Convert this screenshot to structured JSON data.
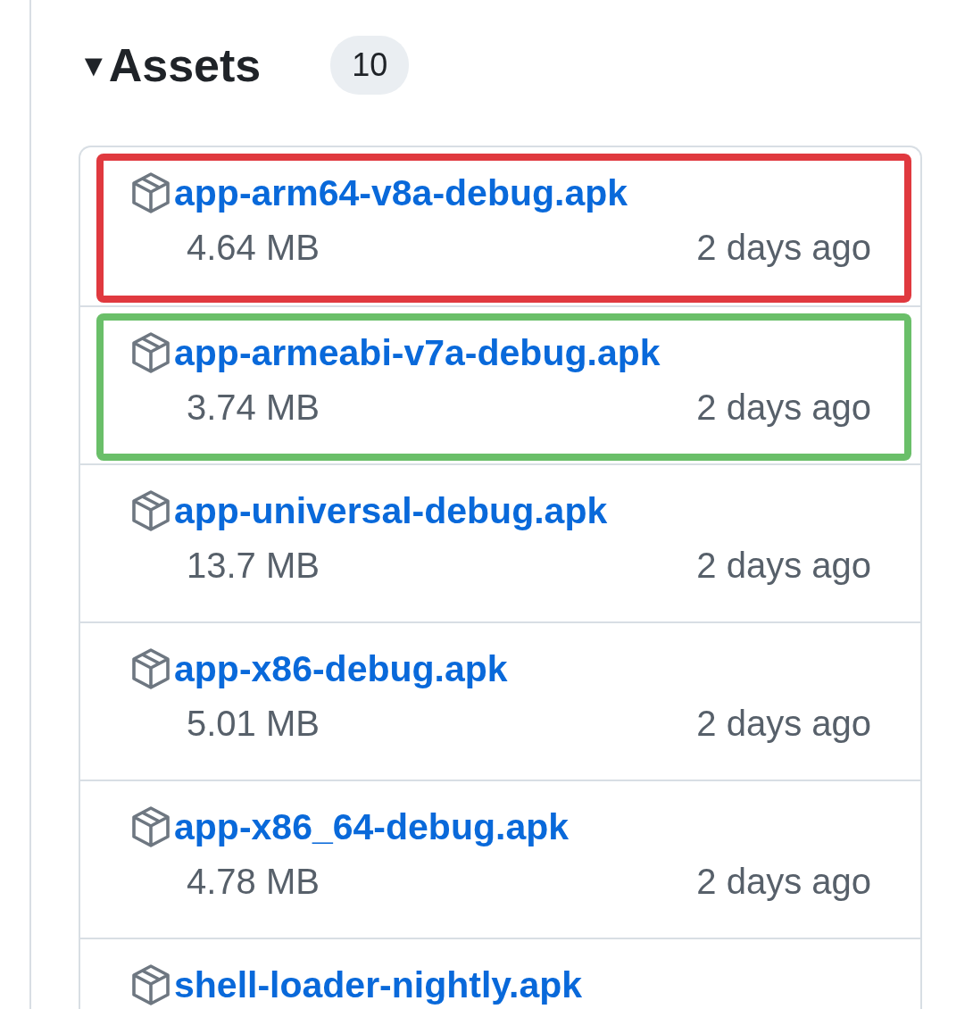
{
  "assets": {
    "toggle": "▼",
    "title": "Assets",
    "count": "10",
    "expanded": true,
    "items": [
      {
        "name": "app-arm64-v8a-debug.apk",
        "size": "4.64 MB",
        "date": "2 days ago",
        "color": "#e0393f"
      },
      {
        "name": "app-armeabi-v7a-debug.apk",
        "size": "3.74 MB",
        "date": "2 days ago",
        "color": "#6abf69"
      },
      {
        "name": "app-universal-debug.apk",
        "size": "13.7 MB",
        "date": "2 days ago"
      },
      {
        "name": "app-x86-debug.apk",
        "size": "5.01 MB",
        "date": "2 days ago"
      },
      {
        "name": "app-x86_64-debug.apk",
        "size": "4.78 MB",
        "date": "2 days ago"
      },
      {
        "name": "shell-loader-nightly.apk"
      }
    ]
  }
}
